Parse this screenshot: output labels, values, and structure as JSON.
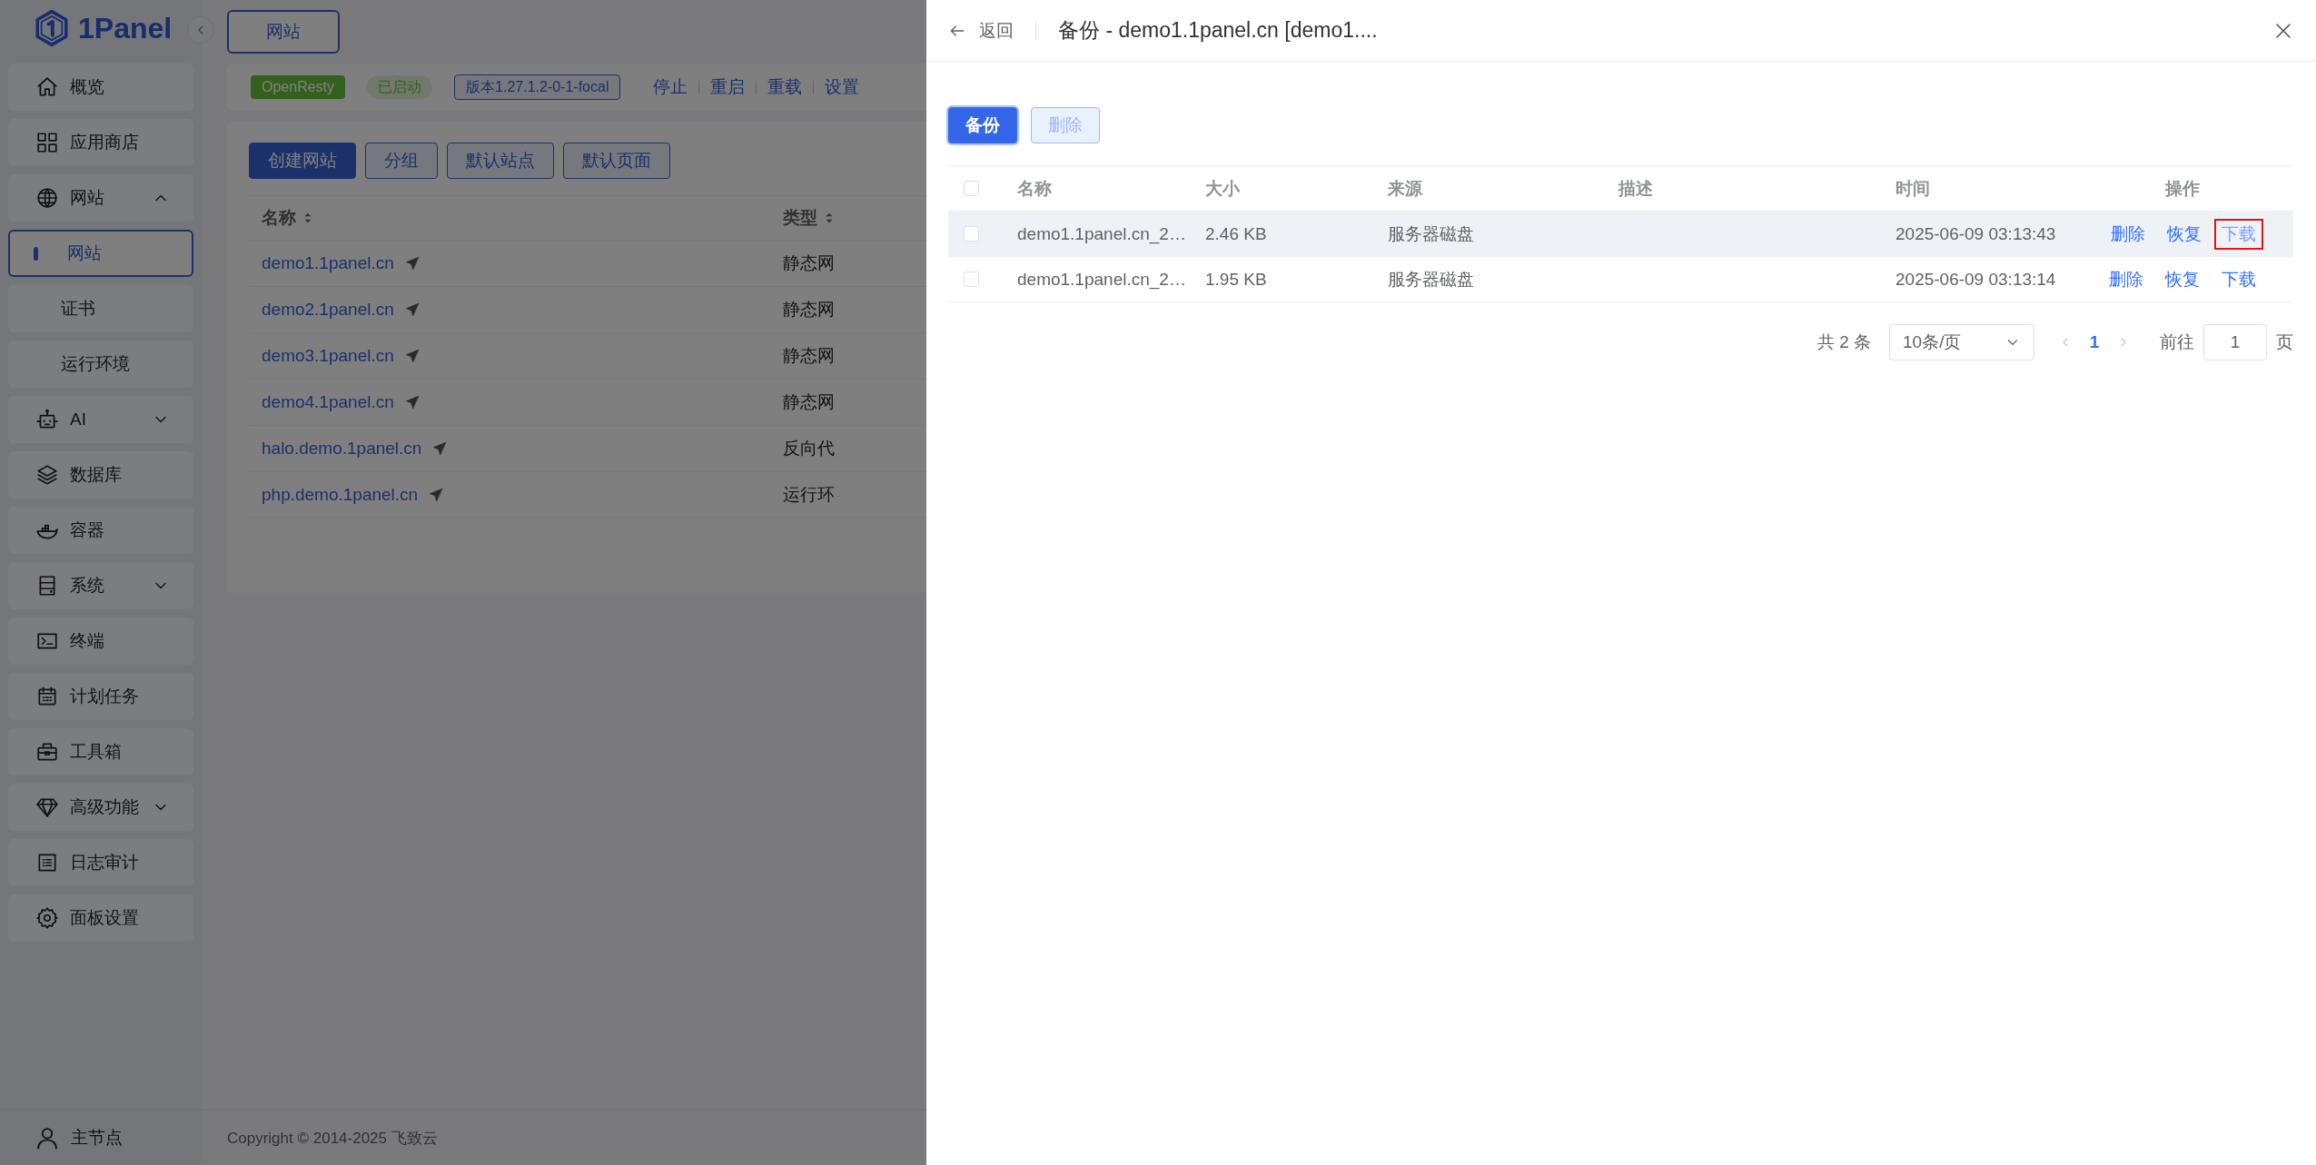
{
  "sidebar": {
    "logo": "1Panel",
    "items": [
      {
        "label": "概览",
        "kind": "item",
        "selected": false
      },
      {
        "label": "应用商店",
        "kind": "item",
        "selected": false
      },
      {
        "label": "网站",
        "kind": "group",
        "expanded": true,
        "children": [
          {
            "label": "网站",
            "selected": true
          },
          {
            "label": "证书",
            "selected": false
          },
          {
            "label": "运行环境",
            "selected": false
          }
        ]
      },
      {
        "label": "AI",
        "kind": "group",
        "expanded": false
      },
      {
        "label": "数据库",
        "kind": "item",
        "selected": false
      },
      {
        "label": "容器",
        "kind": "item",
        "selected": false
      },
      {
        "label": "系统",
        "kind": "group",
        "expanded": false
      },
      {
        "label": "终端",
        "kind": "item",
        "selected": false
      },
      {
        "label": "计划任务",
        "kind": "item",
        "selected": false
      },
      {
        "label": "工具箱",
        "kind": "item",
        "selected": false
      },
      {
        "label": "高级功能",
        "kind": "group",
        "expanded": false
      },
      {
        "label": "日志审计",
        "kind": "item",
        "selected": false
      },
      {
        "label": "面板设置",
        "kind": "item",
        "selected": false
      }
    ],
    "footer": "主节点"
  },
  "main": {
    "tabs": [
      {
        "label": "网站",
        "selected": true
      }
    ],
    "status": {
      "app": "OpenResty",
      "state": "已启动",
      "version": "版本1.27.1.2-0-1-focal",
      "actions": [
        "停止",
        "重启",
        "重载",
        "设置"
      ]
    },
    "buttons": [
      {
        "label": "创建网站",
        "kind": "primary"
      },
      {
        "label": "分组",
        "kind": "plain"
      },
      {
        "label": "默认站点",
        "kind": "plain"
      },
      {
        "label": "默认页面",
        "kind": "plain"
      }
    ],
    "table": {
      "columns": [
        {
          "label": "名称",
          "sortable": true
        },
        {
          "label": "类型",
          "sortable": true
        }
      ],
      "rows": [
        {
          "name": "demo1.1panel.cn",
          "type": "静态网"
        },
        {
          "name": "demo2.1panel.cn",
          "type": "静态网"
        },
        {
          "name": "demo3.1panel.cn",
          "type": "静态网"
        },
        {
          "name": "demo4.1panel.cn",
          "type": "静态网"
        },
        {
          "name": "halo.demo.1panel.cn",
          "type": "反向代"
        },
        {
          "name": "php.demo.1panel.cn",
          "type": "运行环"
        }
      ]
    },
    "footer": "Copyright © 2014-2025 飞致云"
  },
  "drawer": {
    "back": "返回",
    "title": "备份 - demo1.1panel.cn [demo1....",
    "buttons": [
      {
        "label": "备份",
        "kind": "primary",
        "disabled": false
      },
      {
        "label": "删除",
        "kind": "plain",
        "disabled": true
      }
    ],
    "table": {
      "select_all": false,
      "columns": [
        "名称",
        "大小",
        "来源",
        "描述",
        "时间",
        "操作"
      ],
      "rows": [
        {
          "checked": false,
          "hovered": true,
          "name": "demo1.1panel.cn_2…",
          "size": "2.46 KB",
          "source": "服务器磁盘",
          "time": "2025-06-09 03:13:43",
          "actions": [
            {
              "label": "删除",
              "highlighted": false
            },
            {
              "label": "恢复",
              "highlighted": false
            },
            {
              "label": "下载",
              "highlighted": true
            }
          ]
        },
        {
          "checked": false,
          "hovered": false,
          "name": "demo1.1panel.cn_2…",
          "size": "1.95 KB",
          "source": "服务器磁盘",
          "time": "2025-06-09 03:13:14",
          "actions": [
            {
              "label": "删除",
              "highlighted": false
            },
            {
              "label": "恢复",
              "highlighted": false
            },
            {
              "label": "下载",
              "highlighted": false
            }
          ]
        }
      ]
    },
    "pagination": {
      "total": "共 2 条",
      "page_size": "10条/页",
      "pages": [
        {
          "label": "1",
          "selected": true
        }
      ],
      "goto_label": "前往",
      "goto_value": "1",
      "suffix": "页"
    }
  }
}
